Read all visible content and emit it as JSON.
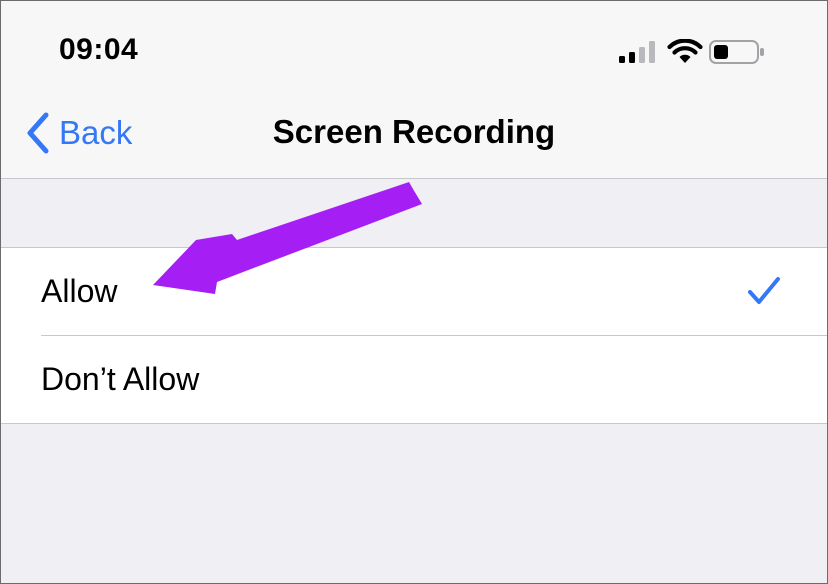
{
  "status_bar": {
    "time": "09:04",
    "signal_icon": "cellular-signal-icon",
    "wifi_icon": "wifi-icon",
    "battery_icon": "battery-low-icon"
  },
  "nav": {
    "back_label": "Back",
    "title": "Screen Recording"
  },
  "options": [
    {
      "label": "Allow",
      "selected": true
    },
    {
      "label": "Don’t Allow",
      "selected": false
    }
  ],
  "annotation": {
    "arrow_color": "#a51ff5"
  },
  "colors": {
    "accent": "#3478f6",
    "background": "#efeff4"
  }
}
